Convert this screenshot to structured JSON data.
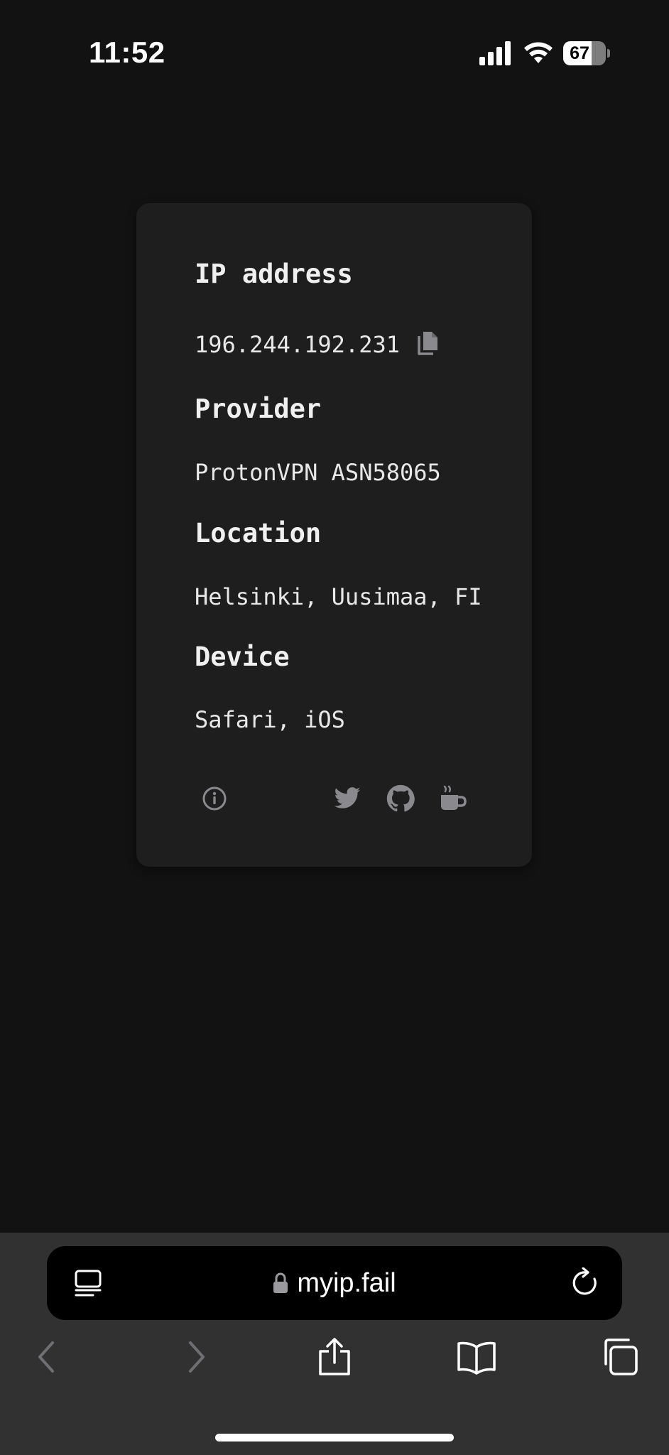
{
  "status_bar": {
    "time": "11:52",
    "battery_percent": 67,
    "battery_label": "67",
    "icons": [
      "signal-icon",
      "wifi-icon",
      "battery-icon"
    ]
  },
  "card": {
    "ip_heading": "IP address",
    "ip_value": "196.244.192.231",
    "provider_heading": "Provider",
    "provider_value": "ProtonVPN ASN58065",
    "location_heading": "Location",
    "location_value": "Helsinki, Uusimaa, FI",
    "device_heading": "Device",
    "device_value": "Safari, iOS",
    "footer_icons": [
      "info-icon",
      "twitter-icon",
      "github-icon",
      "coffee-icon"
    ]
  },
  "browser": {
    "url": "myip.fail",
    "toolbar_icons": [
      "reader-icon",
      "lock-icon",
      "reload-icon",
      "back-icon",
      "forward-icon",
      "share-icon",
      "bookmarks-icon",
      "tabs-icon"
    ]
  },
  "colors": {
    "background": "#121212",
    "card": "#1e1e1f",
    "icon_gray": "#8a8a8e",
    "chrome": "#313131",
    "address_bar": "#000000"
  }
}
